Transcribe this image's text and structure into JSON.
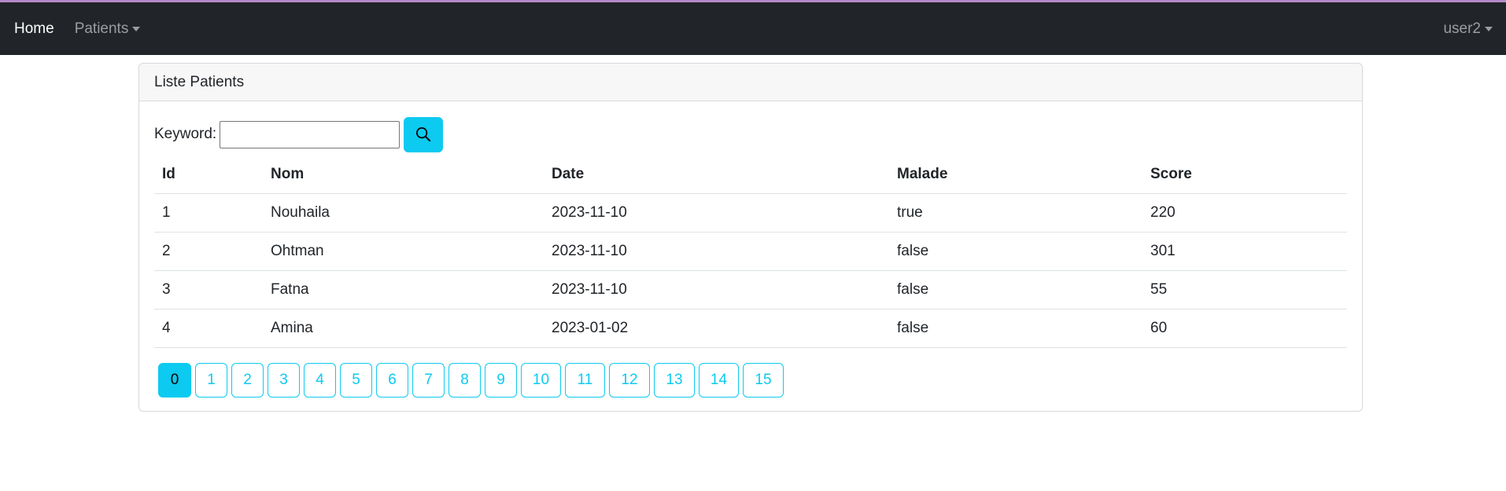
{
  "nav": {
    "home": "Home",
    "patients": "Patients",
    "user": "user2"
  },
  "card": {
    "title": "Liste Patients"
  },
  "search": {
    "label": "Keyword:",
    "value": "",
    "button_icon": "search-icon"
  },
  "table": {
    "headers": [
      "Id",
      "Nom",
      "Date",
      "Malade",
      "Score"
    ],
    "rows": [
      [
        "1",
        "Nouhaila",
        "2023-11-10",
        "true",
        "220"
      ],
      [
        "2",
        "Ohtman",
        "2023-11-10",
        "false",
        "301"
      ],
      [
        "3",
        "Fatna",
        "2023-11-10",
        "false",
        "55"
      ],
      [
        "4",
        "Amina",
        "2023-01-02",
        "false",
        "60"
      ]
    ]
  },
  "pagination": {
    "pages": [
      "0",
      "1",
      "2",
      "3",
      "4",
      "5",
      "6",
      "7",
      "8",
      "9",
      "10",
      "11",
      "12",
      "13",
      "14",
      "15"
    ],
    "current": "0"
  },
  "colors": {
    "accent": "#0dcaf0",
    "navbar": "#212529",
    "top_border": "#b58ac9"
  }
}
